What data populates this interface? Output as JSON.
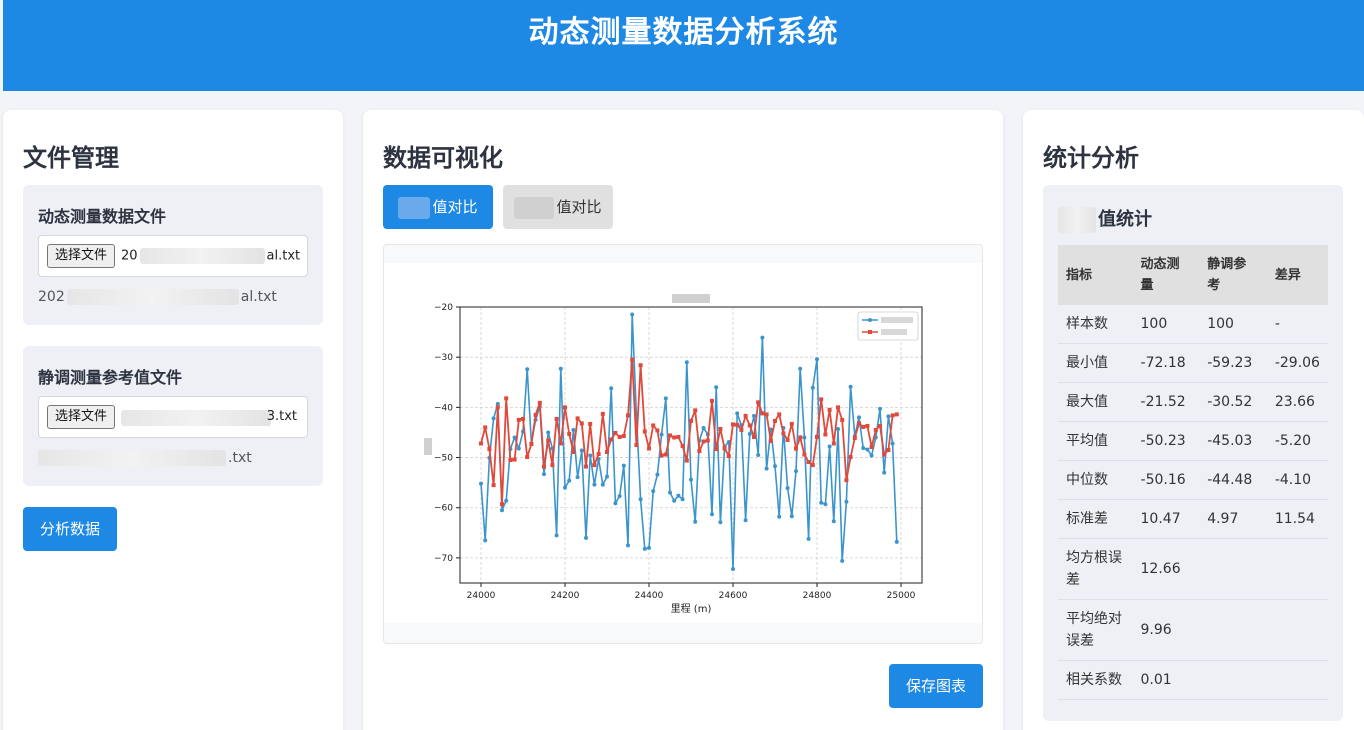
{
  "header": {
    "title": "动态测量数据分析系统"
  },
  "file_panel": {
    "title": "文件管理",
    "dynamic": {
      "label": "动态测量数据文件",
      "button": "选择文件",
      "input_prefix": "20",
      "input_suffix": "al.txt",
      "selected_prefix": "202",
      "selected_suffix": "al.txt"
    },
    "static": {
      "label": "静调测量参考值文件",
      "button": "选择文件",
      "input_suffix": "3.txt",
      "selected_suffix": ".txt"
    },
    "analyze_button": "分析数据"
  },
  "viz_panel": {
    "title": "数据可视化",
    "tab_1": "值对比",
    "tab_2": "值对比",
    "save_button": "保存图表"
  },
  "stats_panel": {
    "title": "统计分析",
    "section_title": "值统计",
    "headers": [
      "指标",
      "动态测量",
      "静调参考",
      "差异"
    ],
    "rows": [
      [
        "样本数",
        "100",
        "100",
        "-"
      ],
      [
        "最小值",
        "-72.18",
        "-59.23",
        "-29.06"
      ],
      [
        "最大值",
        "-21.52",
        "-30.52",
        "23.66"
      ],
      [
        "平均值",
        "-50.23",
        "-45.03",
        "-5.20"
      ],
      [
        "中位数",
        "-50.16",
        "-44.48",
        "-4.10"
      ],
      [
        "标准差",
        "10.47",
        "4.97",
        "11.54"
      ],
      [
        "均方根误差",
        "12.66",
        "",
        ""
      ],
      [
        "平均绝对误差",
        "9.96",
        "",
        ""
      ],
      [
        "相关系数",
        "0.01",
        "",
        ""
      ]
    ]
  },
  "chart_data": {
    "type": "line",
    "title": "",
    "xlabel": "里程 (m)",
    "ylabel": "",
    "xlim": [
      23950,
      25050
    ],
    "ylim": [
      -75,
      -20
    ],
    "xticks": [
      24000,
      24200,
      24400,
      24600,
      24800,
      25000
    ],
    "yticks": [
      -20,
      -30,
      -40,
      -50,
      -60,
      -70
    ],
    "grid": true,
    "legend_position": "top-right",
    "colors": {
      "dynamic": "#3b95cc",
      "static": "#df4a3c"
    },
    "x_start": 24000,
    "x_step": 10,
    "series": [
      {
        "name": "",
        "values": [
          -55.2,
          -66.5,
          -50.1,
          -42.2,
          -39.3,
          -60.5,
          -58.6,
          -48.3,
          -46.0,
          -48.2,
          -44.8,
          -32.4,
          -47.2,
          -42.5,
          -39.8,
          -53.3,
          -45.0,
          -48.2,
          -65.5,
          -32.3,
          -56.0,
          -54.6,
          -44.5,
          -53.9,
          -48.6,
          -66.0,
          -49.6,
          -55.4,
          -50.3,
          -55.4,
          -53.8,
          -36.2,
          -59.1,
          -57.7,
          -51.6,
          -67.5,
          -21.5,
          -41.5,
          -58.3,
          -68.2,
          -68.0,
          -56.7,
          -53.4,
          -45.4,
          -38.2,
          -57.0,
          -58.6,
          -57.6,
          -58.3,
          -31.0,
          -54.4,
          -62.8,
          -46.6,
          -44.1,
          -45.4,
          -61.3,
          -36.0,
          -62.9,
          -47.8,
          -46.9,
          -72.2,
          -41.2,
          -43.6,
          -62.5,
          -45.3,
          -41.7,
          -49.5,
          -26.1,
          -52.2,
          -44.4,
          -51.7,
          -61.8,
          -44.1,
          -56.1,
          -61.7,
          -52.7,
          -32.3,
          -46.0,
          -66.2,
          -36.1,
          -30.4,
          -59.0,
          -59.3,
          -47.8,
          -62.7,
          -44.3,
          -70.6,
          -58.8,
          -35.9,
          -45.7,
          -42.0,
          -48.1,
          -48.4,
          -49.6,
          -46.0,
          -40.3,
          -53.0,
          -41.8,
          -47.2,
          -66.8
        ]
      },
      {
        "name": "",
        "values": [
          -47.2,
          -44.0,
          -48.3,
          -55.5,
          -40.0,
          -59.3,
          -38.2,
          -50.5,
          -50.4,
          -42.5,
          -42.3,
          -49.9,
          -47.3,
          -41.5,
          -39.1,
          -51.8,
          -46.6,
          -51.5,
          -42.3,
          -47.2,
          -40.0,
          -45.3,
          -48.9,
          -42.2,
          -43.2,
          -51.8,
          -43.3,
          -51.5,
          -49.3,
          -41.3,
          -48.9,
          -46.4,
          -45.1,
          -45.9,
          -45.7,
          -41.6,
          -30.5,
          -47.5,
          -31.6,
          -44.8,
          -48.2,
          -43.6,
          -44.6,
          -49.6,
          -49.4,
          -45.6,
          -46.0,
          -45.9,
          -47.7,
          -50.6,
          -42.7,
          -40.6,
          -48.7,
          -46.8,
          -46.6,
          -38.7,
          -48.3,
          -44.3,
          -48.2,
          -49.7,
          -43.4,
          -43.5,
          -44.5,
          -41.7,
          -43.6,
          -45.9,
          -39.0,
          -41.2,
          -41.4,
          -46.7,
          -42.7,
          -41.4,
          -45.2,
          -46.5,
          -43.3,
          -48.2,
          -46.0,
          -49.4,
          -50.9,
          -51.5,
          -45.9,
          -38.4,
          -45.4,
          -40.5,
          -47.2,
          -40.0,
          -42.5,
          -54.5,
          -49.9,
          -46.1,
          -43.2,
          -43.9,
          -43.7,
          -47.9,
          -44.5,
          -43.7,
          -49.4,
          -48.5,
          -41.6,
          -41.4
        ]
      }
    ]
  }
}
